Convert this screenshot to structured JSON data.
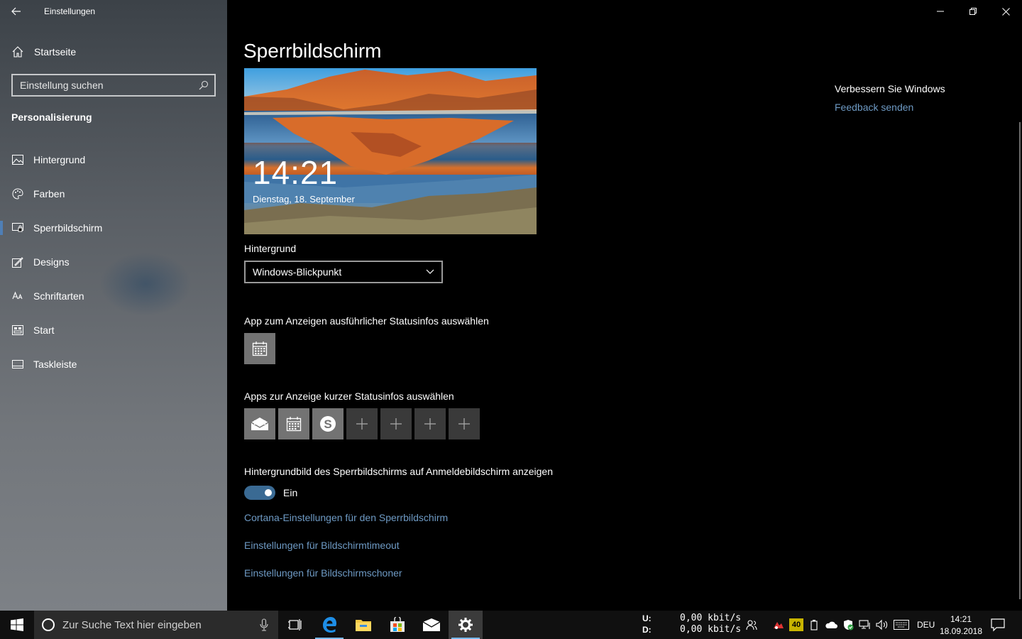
{
  "window": {
    "app_title": "Einstellungen",
    "controls": [
      "minimize",
      "restore",
      "close"
    ]
  },
  "sidebar": {
    "home_label": "Startseite",
    "search_placeholder": "Einstellung suchen",
    "section_title": "Personalisierung",
    "items": [
      {
        "label": "Hintergrund",
        "icon": "picture-icon"
      },
      {
        "label": "Farben",
        "icon": "palette-icon"
      },
      {
        "label": "Sperrbildschirm",
        "icon": "lock-screen-icon",
        "active": true
      },
      {
        "label": "Designs",
        "icon": "brush-icon"
      },
      {
        "label": "Schriftarten",
        "icon": "font-icon"
      },
      {
        "label": "Start",
        "icon": "start-icon"
      },
      {
        "label": "Taskleiste",
        "icon": "taskbar-icon"
      }
    ]
  },
  "main": {
    "page_title": "Sperrbildschirm",
    "preview": {
      "time": "14:21",
      "date": "Dienstag, 18. September"
    },
    "background_label": "Hintergrund",
    "background_value": "Windows-Blickpunkt",
    "detailed_status_label": "App zum Anzeigen ausführlicher Statusinfos auswählen",
    "quick_status_label": "Apps zur Anzeige kurzer Statusinfos auswählen",
    "quick_status_apps": [
      "mail-icon",
      "calendar-icon",
      "skype-icon",
      "add-icon",
      "add-icon",
      "add-icon",
      "add-icon"
    ],
    "signin_bg_label": "Hintergrundbild des Sperrbildschirms auf Anmeldebildschirm anzeigen",
    "signin_bg_toggle": true,
    "toggle_state_label": "Ein",
    "links": [
      "Cortana-Einstellungen für den Sperrbildschirm",
      "Einstellungen für Bildschirmtimeout",
      "Einstellungen für Bildschirmschoner"
    ]
  },
  "help": {
    "heading": "Verbessern Sie Windows",
    "feedback_link": "Feedback senden"
  },
  "taskbar": {
    "search_placeholder": "Zur Suche Text hier eingeben",
    "pinned": [
      "task-view-icon",
      "edge-icon",
      "file-explorer-icon",
      "store-icon",
      "mail-icon",
      "settings-icon"
    ],
    "net_upload_label": "U:",
    "net_download_label": "D:",
    "net_upload_value": "0,00 kbit/s",
    "net_download_value": "0,00 kbit/s",
    "tray_badge": "40",
    "language": "DEU",
    "time": "14:21",
    "date": "18.09.2018"
  }
}
